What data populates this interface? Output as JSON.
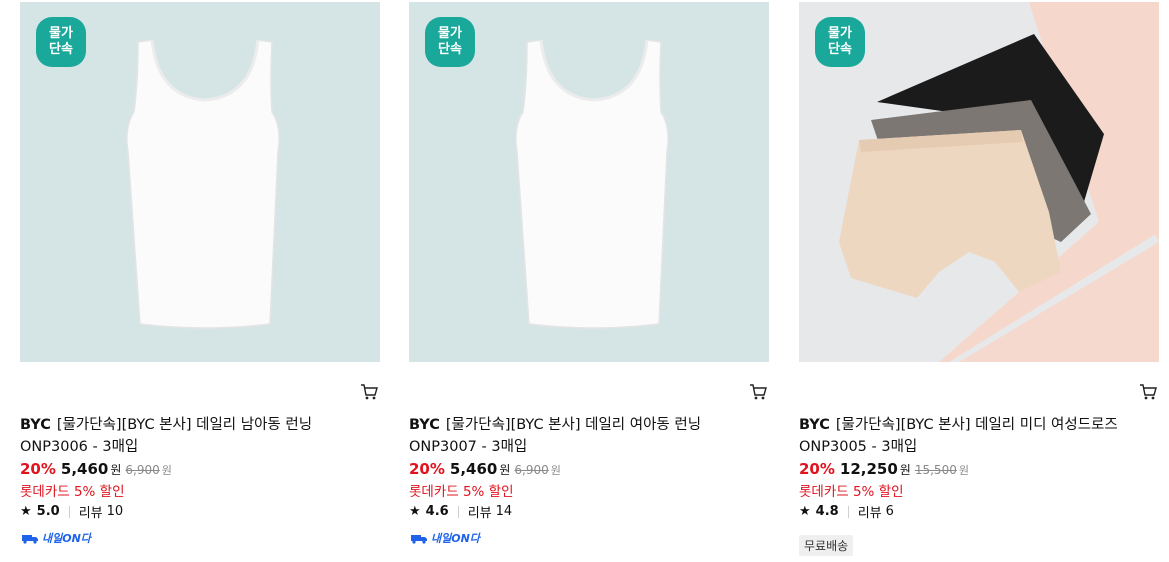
{
  "badge": {
    "line1": "물가",
    "line2": "단속"
  },
  "products": [
    {
      "brand": "BYC",
      "title": "[물가단속][BYC 본사] 데일리 남아동 런닝 ONP3006 - 3매입",
      "discount_rate": "20%",
      "sale_price": "5,460",
      "sale_unit": "원",
      "original_price": "6,900",
      "original_unit": "원",
      "card_discount": "롯데카드 5% 할인",
      "rating": "5.0",
      "review_label": "리뷰",
      "review_count": "10",
      "delivery_label": "내일ON다"
    },
    {
      "brand": "BYC",
      "title": "[물가단속][BYC 본사] 데일리 여아동 런닝 ONP3007 - 3매입",
      "discount_rate": "20%",
      "sale_price": "5,460",
      "sale_unit": "원",
      "original_price": "6,900",
      "original_unit": "원",
      "card_discount": "롯데카드 5% 할인",
      "rating": "4.6",
      "review_label": "리뷰",
      "review_count": "14",
      "delivery_label": "내일ON다"
    },
    {
      "brand": "BYC",
      "title": "[물가단속][BYC 본사] 데일리 미디 여성드로즈 ONP3005 - 3매입",
      "discount_rate": "20%",
      "sale_price": "12,250",
      "sale_unit": "원",
      "original_price": "15,500",
      "original_unit": "원",
      "card_discount": "롯데카드 5% 할인",
      "rating": "4.8",
      "review_label": "리뷰",
      "review_count": "6",
      "shipping_tag": "무료배송"
    }
  ],
  "colors": {
    "accent_red": "#e0131e",
    "badge_teal": "#1aa89b",
    "delivery_blue": "#1e63e9"
  },
  "icons": {
    "cart": "cart-icon",
    "star": "star-icon",
    "delivery": "delivery-truck-icon"
  }
}
